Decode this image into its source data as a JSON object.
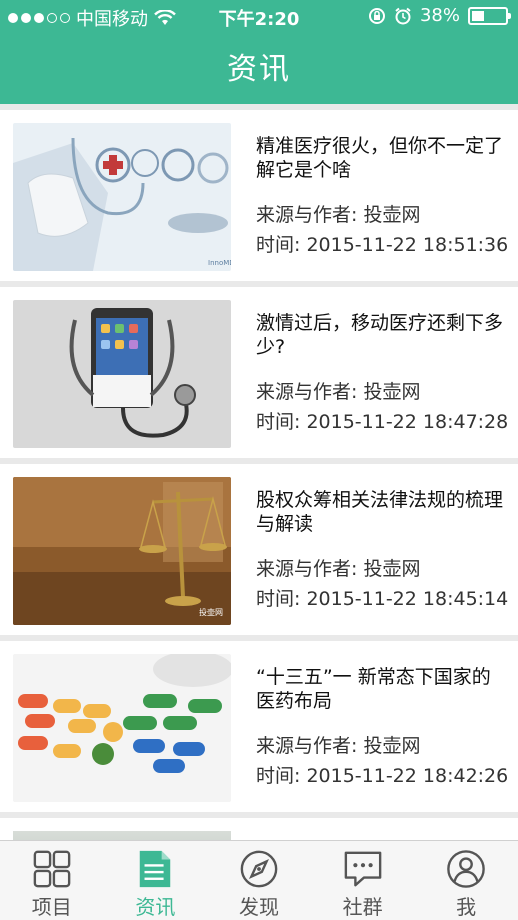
{
  "status_bar": {
    "carrier": "中国移动",
    "time": "下午2:20",
    "battery": "38%",
    "battery_level": 0.38
  },
  "header": {
    "title": "资讯"
  },
  "articles": [
    {
      "title": "精准医疗很火，但你不一定了解它是个啥",
      "source": "来源与作者: 投壶网",
      "time": "时间: 2015-11-22 18:51:36",
      "thumb": "precision-medicine-image"
    },
    {
      "title": "激情过后，移动医疗还剩下多少?",
      "source": "来源与作者: 投壶网",
      "time": "时间: 2015-11-22 18:47:28",
      "thumb": "phone-stethoscope-image"
    },
    {
      "title": "股权众筹相关法律法规的梳理与解读",
      "source": "来源与作者: 投壶网",
      "time": "时间: 2015-11-22 18:45:14",
      "thumb": "justice-scale-image",
      "watermark": "投壶网"
    },
    {
      "title": "“十三五”一 新常态下国家的医药布局",
      "source": "来源与作者: 投壶网",
      "time": "时间: 2015-11-22 18:42:26",
      "thumb": "pills-image"
    }
  ],
  "tabs": [
    {
      "label": "项目",
      "icon": "grid-icon"
    },
    {
      "label": "资讯",
      "icon": "document-icon",
      "active": true
    },
    {
      "label": "发现",
      "icon": "compass-icon"
    },
    {
      "label": "社群",
      "icon": "chat-icon"
    },
    {
      "label": "我",
      "icon": "user-icon"
    }
  ],
  "colors": {
    "accent": "#3db894",
    "tab_inactive": "#555555"
  }
}
